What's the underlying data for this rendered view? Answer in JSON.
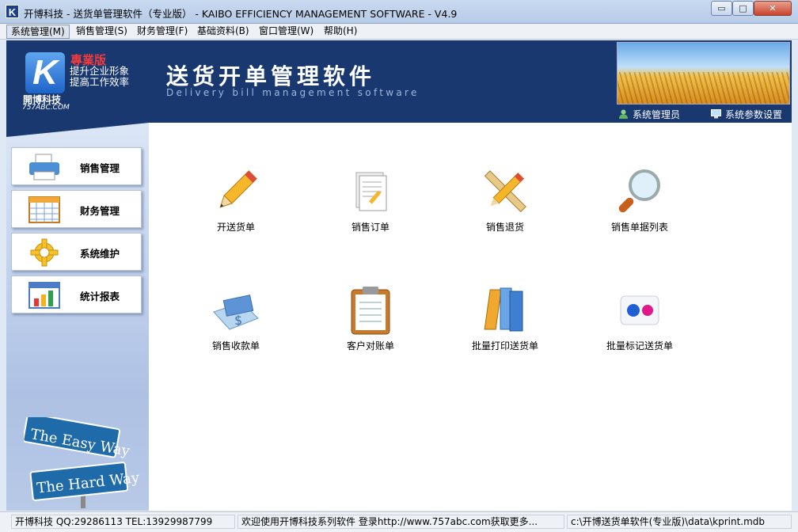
{
  "window": {
    "title": "开博科技 - 送货单管理软件（专业版） - KAIBO EFFICIENCY MANAGEMENT SOFTWARE - V4.9",
    "minimize": "▭",
    "maximize": "□",
    "close": "✕"
  },
  "menu": {
    "items": [
      {
        "label": "系统管理(M)"
      },
      {
        "label": "销售管理(S)"
      },
      {
        "label": "财务管理(F)"
      },
      {
        "label": "基础资料(B)"
      },
      {
        "label": "窗口管理(W)"
      },
      {
        "label": "帮助(H)"
      }
    ]
  },
  "banner": {
    "logo_letter": "K",
    "edition": "專業版",
    "slogan": "提升企业形象\n提高工作效率",
    "company": "開博科技",
    "url": "757ABC.COM",
    "title": "送货开单管理软件",
    "subtitle": "Delivery bill management software",
    "user_link": "系统管理员",
    "settings_link": "系统参数设置"
  },
  "sidebar": {
    "items": [
      {
        "label": "销售管理",
        "icon": "printer-icon"
      },
      {
        "label": "财务管理",
        "icon": "calendar-icon"
      },
      {
        "label": "系统维护",
        "icon": "gear-icon"
      },
      {
        "label": "统计报表",
        "icon": "bar-chart-icon"
      }
    ],
    "sign_top": "The Easy Way",
    "sign_bottom": "The Hard Way"
  },
  "tiles": [
    {
      "label": "开送货单",
      "icon": "pencil-icon"
    },
    {
      "label": "销售订单",
      "icon": "document-icon"
    },
    {
      "label": "销售退货",
      "icon": "ruler-pencil-icon"
    },
    {
      "label": "销售单据列表",
      "icon": "magnifier-icon"
    },
    {
      "label": "销售收款单",
      "icon": "money-card-icon"
    },
    {
      "label": "客户对账单",
      "icon": "clipboard-icon"
    },
    {
      "label": "批量打印送货单",
      "icon": "binders-icon"
    },
    {
      "label": "批量标记送货单",
      "icon": "dots-icon"
    }
  ],
  "status": {
    "contact": "开博科技 QQ:29286113 TEL:13929987799",
    "welcome": "欢迎使用开博科技系列软件   登录http://www.757abc.com获取更多...",
    "db_path": "c:\\开博送货单软件(专业版)\\data\\kprint.mdb"
  },
  "colors": {
    "banner_bg": "#18386f",
    "edition_red": "#f23b3b",
    "accent_blue": "#1e64c8"
  }
}
